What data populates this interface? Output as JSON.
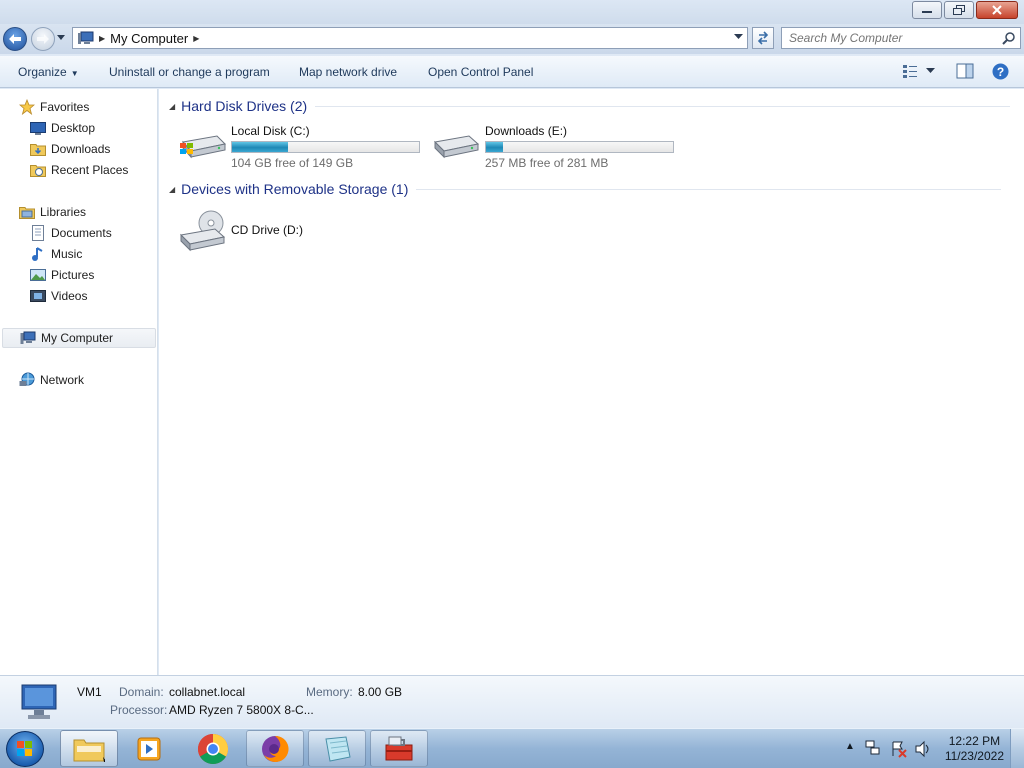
{
  "window": {
    "controls": [
      "minimize",
      "restore",
      "close"
    ]
  },
  "address": {
    "crumbs": [
      "My Computer"
    ],
    "search_placeholder": "Search My Computer"
  },
  "toolbar": {
    "organize": "Organize",
    "uninstall": "Uninstall or change a program",
    "map_drive": "Map network drive",
    "control_panel": "Open Control Panel"
  },
  "nav": {
    "favorites": "Favorites",
    "desktop": "Desktop",
    "downloads": "Downloads",
    "recent": "Recent Places",
    "libraries": "Libraries",
    "documents": "Documents",
    "music": "Music",
    "pictures": "Pictures",
    "videos": "Videos",
    "my_computer": "My Computer",
    "network": "Network"
  },
  "groups": {
    "hdd": {
      "title": "Hard Disk Drives (2)",
      "drives": [
        {
          "name": "Local Disk (C:)",
          "free_text": "104 GB free of 149 GB",
          "used_fraction": 0.3
        },
        {
          "name": "Downloads (E:)",
          "free_text": "257 MB free of 281 MB",
          "used_fraction": 0.09
        }
      ]
    },
    "removable": {
      "title": "Devices with Removable Storage (1)",
      "drives": [
        {
          "name": "CD Drive (D:)"
        }
      ]
    }
  },
  "details": {
    "name": "VM1",
    "domain_label": "Domain:",
    "domain": "collabnet.local",
    "memory_label": "Memory:",
    "memory": "8.00 GB",
    "processor_label": "Processor:",
    "processor": "AMD Ryzen 7 5800X 8-C..."
  },
  "taskbar": {
    "time": "12:22 PM",
    "date": "11/23/2022"
  },
  "colors": {
    "bar_fill": "#26a0da",
    "group_title": "#1e3287",
    "taskbar": "#9dbbd9"
  }
}
